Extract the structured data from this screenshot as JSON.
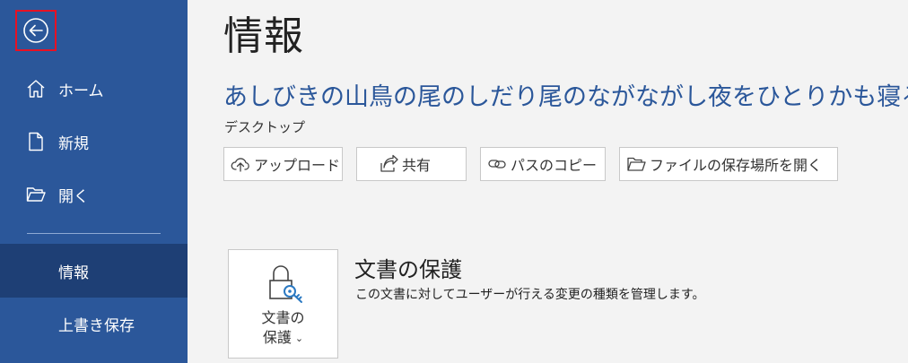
{
  "sidebar": {
    "items": [
      {
        "label": "ホーム",
        "icon": "home-icon"
      },
      {
        "label": "新規",
        "icon": "new-document-icon"
      },
      {
        "label": "開く",
        "icon": "open-folder-icon"
      },
      {
        "label": "情報"
      },
      {
        "label": "上書き保存"
      }
    ],
    "active_item": "情報"
  },
  "main": {
    "page_title": "情報",
    "document_title": "あしびきの山鳥の尾のしだり尾のながながし夜をひとりかも寝る",
    "document_location": "デスクトップ",
    "actions": [
      {
        "label": "アップロード",
        "icon": "upload-icon"
      },
      {
        "label": "共有",
        "icon": "share-icon"
      },
      {
        "label": "パスのコピー",
        "icon": "link-icon"
      },
      {
        "label": "ファイルの保存場所を開く",
        "icon": "open-folder-icon"
      }
    ],
    "protect": {
      "button_line1": "文書の",
      "button_line2": "保護",
      "title": "文書の保護",
      "description": "この文書に対してユーザーが行える変更の種類を管理します。"
    }
  },
  "colors": {
    "sidebar_bg": "#2b579a",
    "sidebar_active_bg": "#1e3f75",
    "accent": "#2b579a",
    "highlight_border": "#e81123"
  }
}
